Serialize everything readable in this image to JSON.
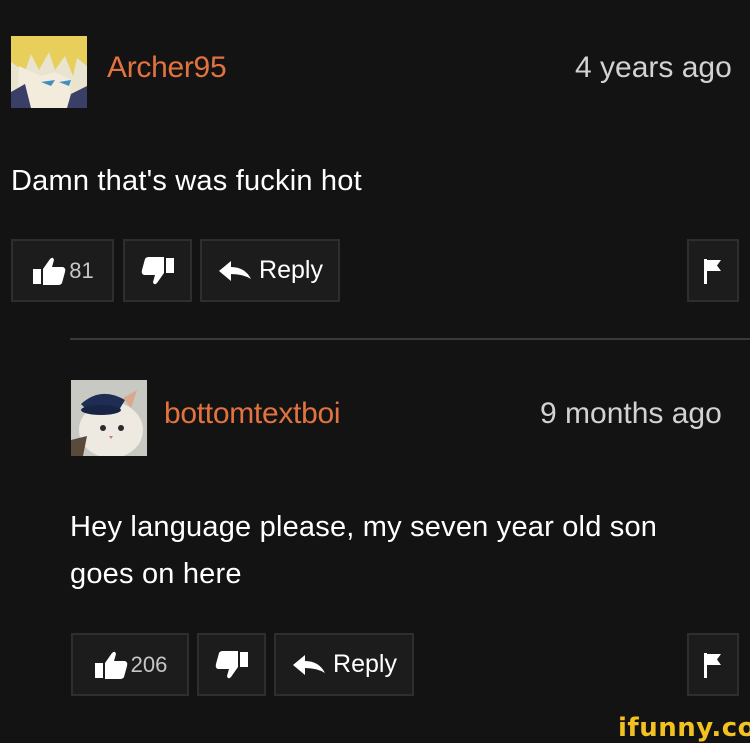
{
  "comments": [
    {
      "username": "Archer95",
      "time": "4 years ago",
      "text": "Damn that's was fuckin hot",
      "likes": "81",
      "reply_label": "Reply",
      "avatar_icon": "anime-boy-avatar",
      "actions": [
        "thumbs-up-icon",
        "thumbs-down-icon",
        "reply-arrow-icon",
        "flag-icon"
      ]
    },
    {
      "username": "bottomtextboi",
      "time": "9 months ago",
      "text_lines": [
        "Hey language please, my seven year old son",
        "goes on here"
      ],
      "likes": "206",
      "reply_label": "Reply",
      "avatar_icon": "cat-with-hat-avatar",
      "actions": [
        "thumbs-up-icon",
        "thumbs-down-icon",
        "reply-arrow-icon",
        "flag-icon"
      ]
    }
  ],
  "watermark": "ifunny.co",
  "colors": {
    "background": "#131313",
    "username": "#e2733f",
    "button_bg": "#1c1c1c",
    "button_border": "#2e2e2e",
    "watermark": "#f4c220"
  }
}
